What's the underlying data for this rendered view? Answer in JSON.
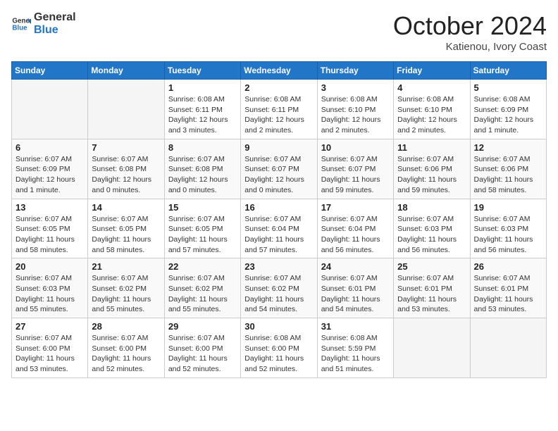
{
  "header": {
    "logo_line1": "General",
    "logo_line2": "Blue",
    "month_title": "October 2024",
    "location": "Katienou, Ivory Coast"
  },
  "weekdays": [
    "Sunday",
    "Monday",
    "Tuesday",
    "Wednesday",
    "Thursday",
    "Friday",
    "Saturday"
  ],
  "weeks": [
    [
      {
        "day": "",
        "info": ""
      },
      {
        "day": "",
        "info": ""
      },
      {
        "day": "1",
        "info": "Sunrise: 6:08 AM\nSunset: 6:11 PM\nDaylight: 12 hours\nand 3 minutes."
      },
      {
        "day": "2",
        "info": "Sunrise: 6:08 AM\nSunset: 6:11 PM\nDaylight: 12 hours\nand 2 minutes."
      },
      {
        "day": "3",
        "info": "Sunrise: 6:08 AM\nSunset: 6:10 PM\nDaylight: 12 hours\nand 2 minutes."
      },
      {
        "day": "4",
        "info": "Sunrise: 6:08 AM\nSunset: 6:10 PM\nDaylight: 12 hours\nand 2 minutes."
      },
      {
        "day": "5",
        "info": "Sunrise: 6:08 AM\nSunset: 6:09 PM\nDaylight: 12 hours\nand 1 minute."
      }
    ],
    [
      {
        "day": "6",
        "info": "Sunrise: 6:07 AM\nSunset: 6:09 PM\nDaylight: 12 hours\nand 1 minute."
      },
      {
        "day": "7",
        "info": "Sunrise: 6:07 AM\nSunset: 6:08 PM\nDaylight: 12 hours\nand 0 minutes."
      },
      {
        "day": "8",
        "info": "Sunrise: 6:07 AM\nSunset: 6:08 PM\nDaylight: 12 hours\nand 0 minutes."
      },
      {
        "day": "9",
        "info": "Sunrise: 6:07 AM\nSunset: 6:07 PM\nDaylight: 12 hours\nand 0 minutes."
      },
      {
        "day": "10",
        "info": "Sunrise: 6:07 AM\nSunset: 6:07 PM\nDaylight: 11 hours\nand 59 minutes."
      },
      {
        "day": "11",
        "info": "Sunrise: 6:07 AM\nSunset: 6:06 PM\nDaylight: 11 hours\nand 59 minutes."
      },
      {
        "day": "12",
        "info": "Sunrise: 6:07 AM\nSunset: 6:06 PM\nDaylight: 11 hours\nand 58 minutes."
      }
    ],
    [
      {
        "day": "13",
        "info": "Sunrise: 6:07 AM\nSunset: 6:05 PM\nDaylight: 11 hours\nand 58 minutes."
      },
      {
        "day": "14",
        "info": "Sunrise: 6:07 AM\nSunset: 6:05 PM\nDaylight: 11 hours\nand 58 minutes."
      },
      {
        "day": "15",
        "info": "Sunrise: 6:07 AM\nSunset: 6:05 PM\nDaylight: 11 hours\nand 57 minutes."
      },
      {
        "day": "16",
        "info": "Sunrise: 6:07 AM\nSunset: 6:04 PM\nDaylight: 11 hours\nand 57 minutes."
      },
      {
        "day": "17",
        "info": "Sunrise: 6:07 AM\nSunset: 6:04 PM\nDaylight: 11 hours\nand 56 minutes."
      },
      {
        "day": "18",
        "info": "Sunrise: 6:07 AM\nSunset: 6:03 PM\nDaylight: 11 hours\nand 56 minutes."
      },
      {
        "day": "19",
        "info": "Sunrise: 6:07 AM\nSunset: 6:03 PM\nDaylight: 11 hours\nand 56 minutes."
      }
    ],
    [
      {
        "day": "20",
        "info": "Sunrise: 6:07 AM\nSunset: 6:03 PM\nDaylight: 11 hours\nand 55 minutes."
      },
      {
        "day": "21",
        "info": "Sunrise: 6:07 AM\nSunset: 6:02 PM\nDaylight: 11 hours\nand 55 minutes."
      },
      {
        "day": "22",
        "info": "Sunrise: 6:07 AM\nSunset: 6:02 PM\nDaylight: 11 hours\nand 55 minutes."
      },
      {
        "day": "23",
        "info": "Sunrise: 6:07 AM\nSunset: 6:02 PM\nDaylight: 11 hours\nand 54 minutes."
      },
      {
        "day": "24",
        "info": "Sunrise: 6:07 AM\nSunset: 6:01 PM\nDaylight: 11 hours\nand 54 minutes."
      },
      {
        "day": "25",
        "info": "Sunrise: 6:07 AM\nSunset: 6:01 PM\nDaylight: 11 hours\nand 53 minutes."
      },
      {
        "day": "26",
        "info": "Sunrise: 6:07 AM\nSunset: 6:01 PM\nDaylight: 11 hours\nand 53 minutes."
      }
    ],
    [
      {
        "day": "27",
        "info": "Sunrise: 6:07 AM\nSunset: 6:00 PM\nDaylight: 11 hours\nand 53 minutes."
      },
      {
        "day": "28",
        "info": "Sunrise: 6:07 AM\nSunset: 6:00 PM\nDaylight: 11 hours\nand 52 minutes."
      },
      {
        "day": "29",
        "info": "Sunrise: 6:07 AM\nSunset: 6:00 PM\nDaylight: 11 hours\nand 52 minutes."
      },
      {
        "day": "30",
        "info": "Sunrise: 6:08 AM\nSunset: 6:00 PM\nDaylight: 11 hours\nand 52 minutes."
      },
      {
        "day": "31",
        "info": "Sunrise: 6:08 AM\nSunset: 5:59 PM\nDaylight: 11 hours\nand 51 minutes."
      },
      {
        "day": "",
        "info": ""
      },
      {
        "day": "",
        "info": ""
      }
    ]
  ]
}
